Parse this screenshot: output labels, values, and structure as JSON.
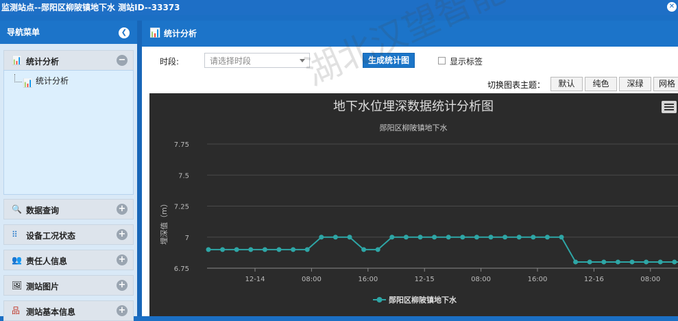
{
  "titlebar": {
    "title": "监测站点--郧阳区柳陂镇地下水  测站ID--33373"
  },
  "sidebar": {
    "header": "导航菜单",
    "sections": [
      {
        "label": "统计分析",
        "icon": "chart-icon",
        "state": "-"
      },
      {
        "label": "数据查询",
        "icon": "search-icon",
        "state": "+"
      },
      {
        "label": "设备工况状态",
        "icon": "grid-icon",
        "state": "+"
      },
      {
        "label": "责任人信息",
        "icon": "people-icon",
        "state": "+"
      },
      {
        "label": "测站图片",
        "icon": "picture-icon",
        "state": "+"
      },
      {
        "label": "测站基本信息",
        "icon": "org-icon",
        "state": "+"
      }
    ],
    "sub_item": "统计分析"
  },
  "main": {
    "title": "统计分析",
    "period_label": "时段:",
    "period_placeholder": "请选择时段",
    "generate_button": "生成统计图",
    "show_labels": "显示标签",
    "theme_label": "切换图表主题：",
    "themes": [
      "默认",
      "纯色",
      "深绿",
      "网格"
    ]
  },
  "watermark": "湖北汉望智能技术有限公司",
  "colors": {
    "accent": "#1c74c9",
    "series": "#2ea6a6",
    "chart_bg": "#2b2b2b"
  },
  "chart_data": {
    "type": "line",
    "title": "地下水位埋深数据统计分析图",
    "subtitle": "郧阳区柳陂镇地下水",
    "ylabel": "埋深值（m）",
    "ylim": [
      6.75,
      7.75
    ],
    "yticks": [
      "7.75",
      "7.5",
      "7.25",
      "7",
      "6.75"
    ],
    "xticks": [
      "12-14",
      "08:00",
      "16:00",
      "12-15",
      "08:00",
      "16:00",
      "12-16",
      "08:00"
    ],
    "grid": true,
    "legend": "bottom-center",
    "series": [
      {
        "name": "郧阳区柳陂镇地下水",
        "values": [
          6.9,
          6.9,
          6.9,
          6.9,
          6.9,
          6.9,
          6.9,
          6.9,
          7.0,
          7.0,
          7.0,
          6.9,
          6.9,
          7.0,
          7.0,
          7.0,
          7.0,
          7.0,
          7.0,
          7.0,
          7.0,
          7.0,
          7.0,
          7.0,
          7.0,
          7.0,
          6.8,
          6.8,
          6.8,
          6.8,
          6.8,
          6.8,
          6.8,
          6.8,
          6.8
        ]
      }
    ]
  }
}
